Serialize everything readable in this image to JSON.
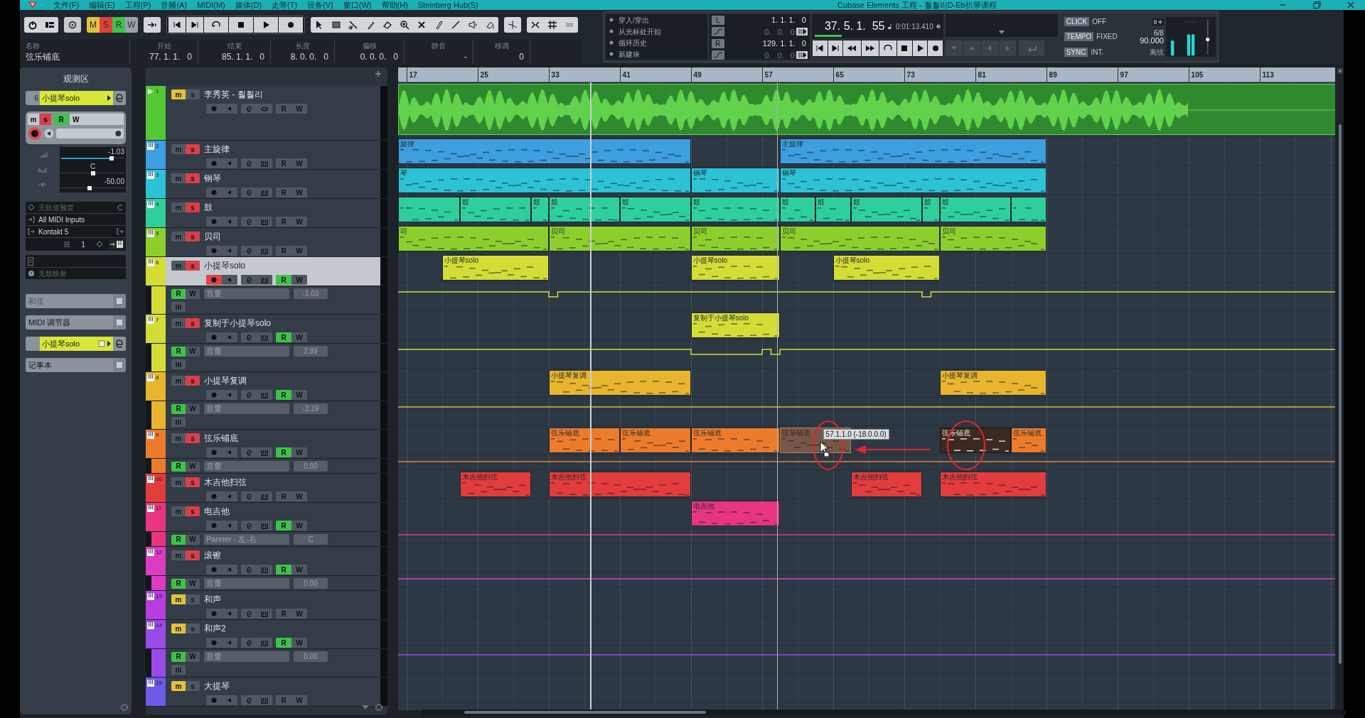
{
  "window": {
    "title": "Cubase Elements 工程 - 훨훨리D-Eb扒带课程"
  },
  "menu": [
    "文件(F)",
    "编辑(E)",
    "工程(P)",
    "音频(A)",
    "MIDI(M)",
    "媒体(D)",
    "走带(T)",
    "设备(V)",
    "窗口(W)",
    "帮助(H)",
    "Steinberg Hub(S)"
  ],
  "mode_buttons": [
    {
      "label": "M",
      "color": "#e2c23c"
    },
    {
      "label": "S",
      "color": "#df3f3f"
    },
    {
      "label": "R",
      "color": "#3ec24a"
    },
    {
      "label": "W",
      "color": "#9aa2aa"
    }
  ],
  "info_line": [
    {
      "label": "名称",
      "value": "弦乐铺底"
    },
    {
      "label": "开始",
      "value": "77. 1. 1.   0"
    },
    {
      "label": "结束",
      "value": "85. 1. 1.   0"
    },
    {
      "label": "长度",
      "value": "8. 0. 0.   0"
    },
    {
      "label": "偏移",
      "value": "0. 0. 0.   0"
    },
    {
      "label": "静音",
      "value": "-"
    },
    {
      "label": "移调",
      "value": "0"
    }
  ],
  "transport": {
    "punch_options": [
      "穿入/穿出",
      "从光标处开始",
      "循环历史",
      "新建块"
    ],
    "left_locator": {
      "label": "L",
      "value": "1. 1. 1.   0",
      "offset": "0.   0.   0"
    },
    "right_locator": {
      "label": "R",
      "value": "129. 1. 1.   0",
      "offset": "0.   0.   0"
    },
    "position": "37. 5. 1.  55",
    "time": "0:01:13.410",
    "click": {
      "label": "CLICK",
      "value": "OFF"
    },
    "tempo": {
      "label": "TEMPO",
      "value": "FIXED",
      "signature": "6/8",
      "bpm": "90.000"
    },
    "sync": {
      "label": "SYNC",
      "value": "INT.",
      "status": "离线"
    }
  },
  "inspector": {
    "title": "观测区",
    "track_number": "6",
    "track_name": "小提琴solo",
    "record": true,
    "buttons": [
      {
        "kind": "mute",
        "label": "m",
        "on": false
      },
      {
        "kind": "solo",
        "label": "s",
        "on": true
      },
      {
        "kind": "read",
        "label": "R",
        "on": true
      },
      {
        "kind": "write",
        "label": "W",
        "on": false
      }
    ],
    "sliders": [
      {
        "kind": "volume",
        "reading": "-1.03",
        "level": 0.8
      },
      {
        "kind": "pan",
        "reading": "C",
        "level": 0.5
      },
      {
        "kind": "send",
        "reading": "-50.00",
        "level": 0.45
      }
    ],
    "preset": "无轨道预置",
    "input": "All MIDI Inputs",
    "output": "Kontakt 5",
    "channel": "1",
    "drum_map": "无鼓映射",
    "sections": [
      {
        "kind": "plain",
        "label": "和弦",
        "dim": true
      },
      {
        "kind": "plain",
        "label": "MIDI 调节器",
        "dim": false
      },
      {
        "kind": "track",
        "label": "小提琴solo"
      },
      {
        "kind": "plain",
        "label": "记事本",
        "dim": false
      }
    ]
  },
  "ruler": [
    "17",
    "25",
    "33",
    "41",
    "49",
    "57",
    "65",
    "73",
    "81",
    "89",
    "97",
    "105",
    "113"
  ],
  "tracks": [
    {
      "kind": "audio",
      "number": "1",
      "name": "李秀英 - 훨훨리",
      "color": "#55c935",
      "record": false,
      "selected": false,
      "buttons": [
        {
          "kind": "mute",
          "label": "m",
          "on": true
        },
        {
          "kind": "solo",
          "label": "s",
          "on": false
        },
        {
          "kind": "read",
          "label": "R",
          "on": false
        },
        {
          "kind": "write",
          "label": "W",
          "on": false
        }
      ],
      "clips": [
        {
          "kind": "audio"
        }
      ]
    },
    {
      "kind": "instrument",
      "number": "2",
      "name": "主旋律",
      "color": "#3d9ee0",
      "record": false,
      "selected": false,
      "buttons": [
        {
          "kind": "mute",
          "label": "m",
          "on": false
        },
        {
          "kind": "solo",
          "label": "s",
          "on": true
        },
        {
          "kind": "read",
          "label": "R",
          "on": false
        },
        {
          "kind": "write",
          "label": "W",
          "on": false
        }
      ],
      "clips": [
        {
          "kind": "midi",
          "label": "旋律"
        },
        {
          "kind": "midi",
          "label": "主旋律"
        }
      ]
    },
    {
      "kind": "instrument",
      "number": "3",
      "name": "钢琴",
      "color": "#2cc3d6",
      "record": false,
      "selected": false,
      "buttons": [
        {
          "kind": "mute",
          "label": "m",
          "on": false
        },
        {
          "kind": "solo",
          "label": "s",
          "on": true
        },
        {
          "kind": "read",
          "label": "R",
          "on": false
        },
        {
          "kind": "write",
          "label": "W",
          "on": false
        }
      ],
      "clips": [
        {
          "kind": "midi",
          "label": "琴"
        },
        {
          "kind": "midi",
          "label": "钢琴"
        },
        {
          "kind": "midi",
          "label": "钢琴"
        }
      ]
    },
    {
      "kind": "instrument",
      "number": "4",
      "name": "鼓",
      "color": "#2fcf9c",
      "record": false,
      "selected": false,
      "buttons": [
        {
          "kind": "mute",
          "label": "m",
          "on": false
        },
        {
          "kind": "solo",
          "label": "s",
          "on": true
        },
        {
          "kind": "read",
          "label": "R",
          "on": false
        },
        {
          "kind": "write",
          "label": "W",
          "on": false
        }
      ],
      "clips": [
        {
          "kind": "midi"
        },
        {
          "kind": "midi",
          "label": "鼓"
        },
        {
          "kind": "midi",
          "label": "鼓"
        },
        {
          "kind": "midi",
          "label": "鼓"
        },
        {
          "kind": "midi",
          "label": "鼓"
        },
        {
          "kind": "midi",
          "label": "鼓"
        },
        {
          "kind": "midi",
          "label": "鼓"
        },
        {
          "kind": "midi",
          "label": "鼓"
        },
        {
          "kind": "midi",
          "label": "鼓"
        },
        {
          "kind": "midi",
          "label": "鼓"
        },
        {
          "kind": "midi",
          "label": "鼓"
        },
        {
          "kind": "midi"
        }
      ]
    },
    {
      "kind": "instrument",
      "number": "5",
      "name": "贝司",
      "color": "#8ccf2c",
      "record": false,
      "selected": false,
      "buttons": [
        {
          "kind": "mute",
          "label": "m",
          "on": false
        },
        {
          "kind": "solo",
          "label": "s",
          "on": true
        },
        {
          "kind": "read",
          "label": "R",
          "on": false
        },
        {
          "kind": "write",
          "label": "W",
          "on": false
        }
      ],
      "clips": [
        {
          "kind": "midi",
          "label": "司"
        },
        {
          "kind": "midi",
          "label": "贝司"
        },
        {
          "kind": "midi",
          "label": "贝司"
        },
        {
          "kind": "midi",
          "label": "贝司"
        },
        {
          "kind": "midi",
          "label": "贝司"
        }
      ]
    },
    {
      "kind": "instrument",
      "number": "6",
      "name": "小提琴solo",
      "color": "#d4dc36",
      "record": true,
      "selected": true,
      "buttons": [
        {
          "kind": "mute",
          "label": "m",
          "on": false
        },
        {
          "kind": "solo",
          "label": "s",
          "on": true
        },
        {
          "kind": "read",
          "label": "R",
          "on": true
        },
        {
          "kind": "write",
          "label": "W",
          "on": false
        }
      ],
      "lane": {
        "param": "音量",
        "value": "-1.03",
        "extra": true,
        "buttons": [
          {
            "kind": "read",
            "label": "R",
            "on": true
          },
          {
            "kind": "write",
            "label": "W",
            "on": false
          }
        ]
      },
      "clips": [
        {
          "kind": "midi",
          "label": "小提琴solo"
        },
        {
          "kind": "midi",
          "label": "小提琴solo"
        },
        {
          "kind": "midi",
          "label": "小提琴solo"
        }
      ]
    },
    {
      "kind": "instrument",
      "number": "7",
      "name": "复制于小提琴solo",
      "color": "#d4dc36",
      "record": false,
      "selected": false,
      "buttons": [
        {
          "kind": "mute",
          "label": "m",
          "on": false
        },
        {
          "kind": "solo",
          "label": "s",
          "on": true
        },
        {
          "kind": "read",
          "label": "R",
          "on": true
        },
        {
          "kind": "write",
          "label": "W",
          "on": false
        }
      ],
      "lane": {
        "param": "音量",
        "value": "2.89",
        "extra": true,
        "buttons": [
          {
            "kind": "read",
            "label": "R",
            "on": true
          },
          {
            "kind": "write",
            "label": "W",
            "on": false
          }
        ]
      },
      "clips": [
        {
          "kind": "midi",
          "label": "复制于小提琴solo"
        }
      ]
    },
    {
      "kind": "instrument",
      "number": "8",
      "name": "小提琴复调",
      "color": "#e8b52e",
      "record": false,
      "selected": false,
      "buttons": [
        {
          "kind": "mute",
          "label": "m",
          "on": false
        },
        {
          "kind": "solo",
          "label": "s",
          "on": true
        },
        {
          "kind": "read",
          "label": "R",
          "on": true
        },
        {
          "kind": "write",
          "label": "W",
          "on": false
        }
      ],
      "lane": {
        "param": "音量",
        "value": "-2.19",
        "extra": true,
        "buttons": [
          {
            "kind": "read",
            "label": "R",
            "on": true
          },
          {
            "kind": "write",
            "label": "W",
            "on": false
          }
        ]
      },
      "clips": [
        {
          "kind": "midi",
          "label": "小提琴复调"
        },
        {
          "kind": "midi",
          "label": "小提琴复调"
        }
      ]
    },
    {
      "kind": "instrument",
      "number": "9",
      "name": "弦乐铺底",
      "color": "#ec7c2c",
      "record": false,
      "selected": false,
      "buttons": [
        {
          "kind": "mute",
          "label": "m",
          "on": false
        },
        {
          "kind": "solo",
          "label": "s",
          "on": true
        },
        {
          "kind": "read",
          "label": "R",
          "on": true
        },
        {
          "kind": "write",
          "label": "W",
          "on": false
        }
      ],
      "lane": {
        "param": "音量",
        "value": "0.00",
        "extra": false,
        "buttons": [
          {
            "kind": "read",
            "label": "R",
            "on": true
          },
          {
            "kind": "write",
            "label": "W",
            "on": false
          }
        ]
      },
      "clips": [
        {
          "kind": "midi",
          "label": "弦乐铺底",
          "selected": false
        },
        {
          "kind": "midi",
          "label": "弦乐铺底",
          "selected": false
        },
        {
          "kind": "midi",
          "label": "弦乐铺底",
          "selected": false
        },
        {
          "kind": "ghost",
          "label": "弦乐铺底",
          "selected": false
        },
        {
          "kind": "midi",
          "label": "弦乐铺底",
          "selected": true
        },
        {
          "kind": "midi",
          "label": "弦乐铺底",
          "selected": false
        }
      ]
    },
    {
      "kind": "instrument",
      "number": "10",
      "name": "木吉他扫弦",
      "color": "#e23c3c",
      "record": false,
      "selected": false,
      "buttons": [
        {
          "kind": "mute",
          "label": "m",
          "on": false
        },
        {
          "kind": "solo",
          "label": "s",
          "on": true
        },
        {
          "kind": "read",
          "label": "R",
          "on": false
        },
        {
          "kind": "write",
          "label": "W",
          "on": false
        }
      ],
      "clips": [
        {
          "kind": "midi",
          "label": "木吉他扫弦"
        },
        {
          "kind": "midi",
          "label": "木吉他扫弦"
        },
        {
          "kind": "midi",
          "label": "木吉他扫弦"
        },
        {
          "kind": "midi",
          "label": "木吉他扫弦"
        }
      ]
    },
    {
      "kind": "instrument",
      "number": "11",
      "name": "电吉他",
      "color": "#e8367e",
      "record": false,
      "selected": false,
      "buttons": [
        {
          "kind": "mute",
          "label": "m",
          "on": false
        },
        {
          "kind": "solo",
          "label": "s",
          "on": true
        },
        {
          "kind": "read",
          "label": "R",
          "on": true
        },
        {
          "kind": "write",
          "label": "W",
          "on": false
        }
      ],
      "lane": {
        "param": "Panner - 左-右",
        "value": "C",
        "extra": false,
        "buttons": [
          {
            "kind": "read",
            "label": "R",
            "on": true
          },
          {
            "kind": "write",
            "label": "W",
            "on": false
          }
        ]
      },
      "clips": [
        {
          "kind": "midi",
          "label": "电吉他"
        }
      ]
    },
    {
      "kind": "instrument",
      "number": "12",
      "name": "滚镲",
      "color": "#dc3cc0",
      "record": false,
      "selected": false,
      "buttons": [
        {
          "kind": "mute",
          "label": "m",
          "on": false
        },
        {
          "kind": "solo",
          "label": "s",
          "on": true
        },
        {
          "kind": "read",
          "label": "R",
          "on": true
        },
        {
          "kind": "write",
          "label": "W",
          "on": false
        }
      ],
      "lane": {
        "param": "音量",
        "value": "0.00",
        "extra": false,
        "buttons": [
          {
            "kind": "read",
            "label": "R",
            "on": true
          },
          {
            "kind": "write",
            "label": "W",
            "on": false
          }
        ]
      }
    },
    {
      "kind": "instrument",
      "number": "13",
      "name": "和声",
      "color": "#b93ce0",
      "record": false,
      "selected": false,
      "buttons": [
        {
          "kind": "mute",
          "label": "m",
          "on": true
        },
        {
          "kind": "solo",
          "label": "s",
          "on": false
        },
        {
          "kind": "read",
          "label": "R",
          "on": false
        },
        {
          "kind": "write",
          "label": "W",
          "on": false
        }
      ]
    },
    {
      "kind": "instrument",
      "number": "14",
      "name": "和声2",
      "color": "#9a4ae6",
      "record": false,
      "selected": false,
      "buttons": [
        {
          "kind": "mute",
          "label": "m",
          "on": true
        },
        {
          "kind": "solo",
          "label": "s",
          "on": false
        },
        {
          "kind": "read",
          "label": "R",
          "on": true
        },
        {
          "kind": "write",
          "label": "W",
          "on": false
        }
      ],
      "lane": {
        "param": "音量",
        "value": "0.00",
        "extra": true,
        "buttons": [
          {
            "kind": "read",
            "label": "R",
            "on": true
          },
          {
            "kind": "write",
            "label": "W",
            "on": false
          }
        ]
      }
    },
    {
      "kind": "instrument",
      "number": "15",
      "name": "大提琴",
      "color": "#6c5ae8",
      "record": false,
      "selected": false,
      "buttons": [
        {
          "kind": "mute",
          "label": "m",
          "on": true
        },
        {
          "kind": "solo",
          "label": "s",
          "on": false
        },
        {
          "kind": "read",
          "label": "R",
          "on": false
        },
        {
          "kind": "write",
          "label": "W",
          "on": false
        }
      ]
    }
  ],
  "drag_tooltip": "57.1.1.0 (-18.0.0.0)"
}
